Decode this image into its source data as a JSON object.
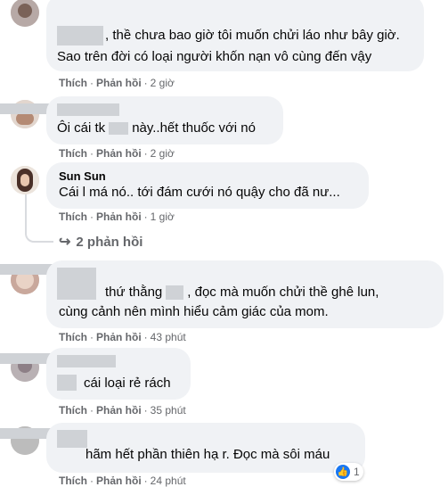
{
  "actions": {
    "like": "Thích",
    "reply": "Phản hồi",
    "separator": "·"
  },
  "comments": [
    {
      "lines": [
        ", thề chưa bao giờ tôi muốn chửi láo như bây giờ.",
        "Sao trên đời có loại người khốn nạn vô cùng đến vậy"
      ],
      "time": "2 giờ"
    },
    {
      "line_prefix": "Ôi cái tk",
      "line_suffix": "này..hết thuốc với nó",
      "time": "2 giờ"
    },
    {
      "author": "Sun Sun",
      "lines": [
        "Cái l má nó.. tới đám cưới nó quậy cho đã nư..."
      ],
      "time": "1 giờ",
      "replies_label": "2 phản hồi"
    },
    {
      "line1_prefix": "thứ thằng",
      "line1_suffix": ", đọc mà muốn chửi thề ghê lun,",
      "line2": "cùng cảnh nên mình hiểu cảm giác của mom.",
      "time": "43 phút"
    },
    {
      "lines": [
        "cái loại rẻ rách"
      ],
      "time": "35 phút"
    },
    {
      "lines": [
        "hãm hết phần thiên hạ r. Đọc mà sôi máu"
      ],
      "time": "24 phút",
      "reaction_count": "1"
    }
  ],
  "icons": {
    "reply_arrow": "reply-arrow-icon",
    "like": "like-reaction-icon"
  },
  "colors": {
    "bubble": "#f0f2f5",
    "meta": "#65676b",
    "text": "#050505",
    "like": "#1877f2"
  }
}
